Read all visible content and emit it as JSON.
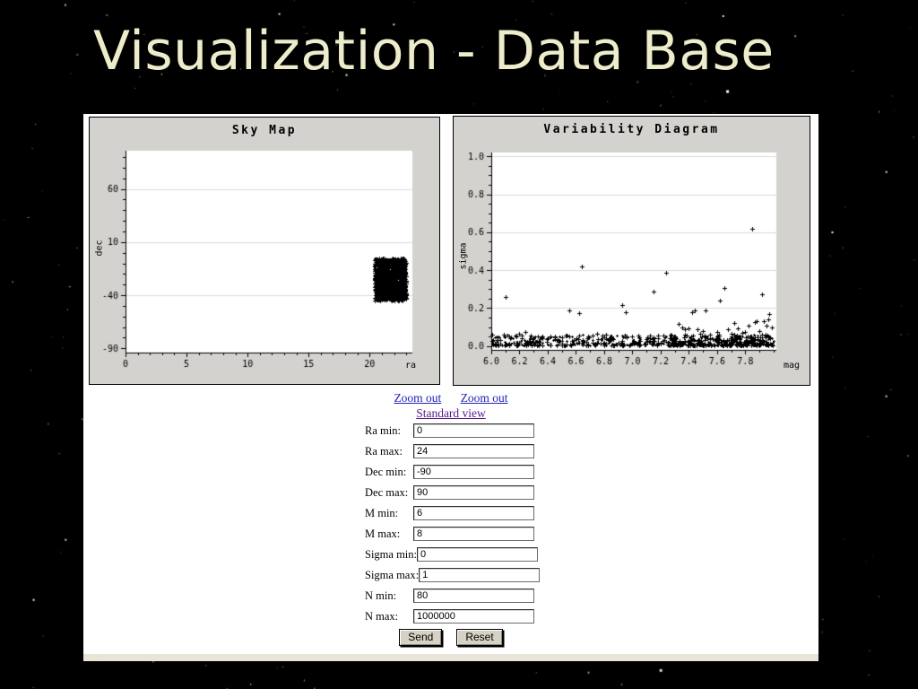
{
  "slide": {
    "title": "Visualization - Data Base"
  },
  "colors": {
    "slide_background": "#000000",
    "title_color": "#EDECCB",
    "page_background": "#FFFFFF",
    "panel_gray": "#D4D2CE",
    "grid_gray": "#DBDBDB",
    "link_blue": "#2222BB",
    "link_visited_purple": "#551A8B",
    "button_face": "#D5D1C5",
    "page_bottom_strip": "#E9E6D8"
  },
  "links": {
    "zoom_out_1": "Zoom out",
    "zoom_out_2": "Zoom out",
    "standard_view": "Standard view"
  },
  "form": {
    "fields": [
      {
        "key": "ra-min",
        "label": "Ra min:",
        "value": "0"
      },
      {
        "key": "ra-max",
        "label": "Ra max:",
        "value": "24"
      },
      {
        "key": "dec-min",
        "label": "Dec min:",
        "value": "-90"
      },
      {
        "key": "dec-max",
        "label": "Dec max:",
        "value": "90"
      },
      {
        "key": "m-min",
        "label": "M min:",
        "value": "6"
      },
      {
        "key": "m-max",
        "label": "M max:",
        "value": "8"
      },
      {
        "key": "sigma-min",
        "label": "Sigma min:",
        "value": "0"
      },
      {
        "key": "sigma-max",
        "label": "Sigma max:",
        "value": "1"
      },
      {
        "key": "n-min",
        "label": "N min:",
        "value": "80"
      },
      {
        "key": "n-max",
        "label": "N max:",
        "value": "1000000"
      }
    ],
    "send_label": "Send",
    "reset_label": "Reset"
  },
  "chart_data": [
    {
      "type": "scatter",
      "title": "Sky Map",
      "xlabel": "ra",
      "ylabel": "dec",
      "xlim": [
        0,
        23.5
      ],
      "ylim": [
        -94,
        96
      ],
      "x_ticks": [
        [
          0,
          "0"
        ],
        [
          5,
          "5"
        ],
        [
          10,
          "10"
        ],
        [
          15,
          "15"
        ],
        [
          20,
          "20"
        ]
      ],
      "x_minor_step": 1,
      "y_ticks": [
        [
          60,
          "60"
        ],
        [
          10,
          "10"
        ],
        [
          -40,
          "-40"
        ],
        [
          -90,
          "-90"
        ]
      ],
      "y_minor_step": 10,
      "grid_y": [
        60,
        10,
        -40
      ],
      "marker": "+",
      "dense_region": {
        "note": "solid cluster of catalog sources",
        "x_min": 20.4,
        "x_max": 23.0,
        "y_min": -45,
        "y_max": -5,
        "count": 1600
      }
    },
    {
      "type": "scatter",
      "title": "Variability Diagram",
      "xlabel": "mag",
      "ylabel": "sigma",
      "xlim": [
        6.0,
        8.02
      ],
      "ylim": [
        -0.02,
        1.02
      ],
      "x_ticks": [
        [
          6.0,
          "6.0"
        ],
        [
          6.2,
          "6.2"
        ],
        [
          6.4,
          "6.4"
        ],
        [
          6.6,
          "6.6"
        ],
        [
          6.8,
          "6.8"
        ],
        [
          7.0,
          "7.0"
        ],
        [
          7.2,
          "7.2"
        ],
        [
          7.4,
          "7.4"
        ],
        [
          7.6,
          "7.6"
        ],
        [
          7.8,
          "7.8"
        ]
      ],
      "x_minor_step": 0.1,
      "y_ticks": [
        [
          0,
          "0.0"
        ],
        [
          0.2,
          "0.2"
        ],
        [
          0.4,
          "0.4"
        ],
        [
          0.6,
          "0.6"
        ],
        [
          0.8,
          "0.8"
        ],
        [
          1.0,
          "1.0"
        ]
      ],
      "y_minor_step": 0.05,
      "grid_y": [
        0.2,
        0.4,
        0.6,
        0.8,
        1.0
      ],
      "marker": "+",
      "baseline_band": {
        "note": "dense band of low-variability stars",
        "x_min": 6.0,
        "x_max": 8.0,
        "y_min": 0.005,
        "y_max": 0.06,
        "count": 680
      },
      "points": [
        [
          6.05,
          0.045
        ],
        [
          6.1,
          0.26
        ],
        [
          6.13,
          0.05
        ],
        [
          6.17,
          0.055
        ],
        [
          6.2,
          0.065
        ],
        [
          6.24,
          0.075
        ],
        [
          6.3,
          0.04
        ],
        [
          6.45,
          0.05
        ],
        [
          6.5,
          0.045
        ],
        [
          6.55,
          0.19
        ],
        [
          6.62,
          0.175
        ],
        [
          6.64,
          0.42
        ],
        [
          6.75,
          0.065
        ],
        [
          6.8,
          0.045
        ],
        [
          6.85,
          0.05
        ],
        [
          6.93,
          0.215
        ],
        [
          6.95,
          0.18
        ],
        [
          7.0,
          0.05
        ],
        [
          7.05,
          0.045
        ],
        [
          7.15,
          0.285
        ],
        [
          7.24,
          0.385
        ],
        [
          7.3,
          0.05
        ],
        [
          7.33,
          0.115
        ],
        [
          7.35,
          0.1
        ],
        [
          7.37,
          0.09
        ],
        [
          7.4,
          0.095
        ],
        [
          7.42,
          0.18
        ],
        [
          7.44,
          0.19
        ],
        [
          7.46,
          0.09
        ],
        [
          7.48,
          0.065
        ],
        [
          7.5,
          0.08
        ],
        [
          7.52,
          0.19
        ],
        [
          7.55,
          0.06
        ],
        [
          7.6,
          0.075
        ],
        [
          7.62,
          0.24
        ],
        [
          7.65,
          0.305
        ],
        [
          7.68,
          0.09
        ],
        [
          7.7,
          0.065
        ],
        [
          7.72,
          0.12
        ],
        [
          7.75,
          0.095
        ],
        [
          7.78,
          0.07
        ],
        [
          7.8,
          0.075
        ],
        [
          7.82,
          0.11
        ],
        [
          7.85,
          0.62
        ],
        [
          7.87,
          0.125
        ],
        [
          7.88,
          0.13
        ],
        [
          7.9,
          0.08
        ],
        [
          7.92,
          0.275
        ],
        [
          7.93,
          0.13
        ],
        [
          7.95,
          0.11
        ],
        [
          7.96,
          0.14
        ],
        [
          7.97,
          0.17
        ],
        [
          7.99,
          0.1
        ]
      ]
    }
  ]
}
